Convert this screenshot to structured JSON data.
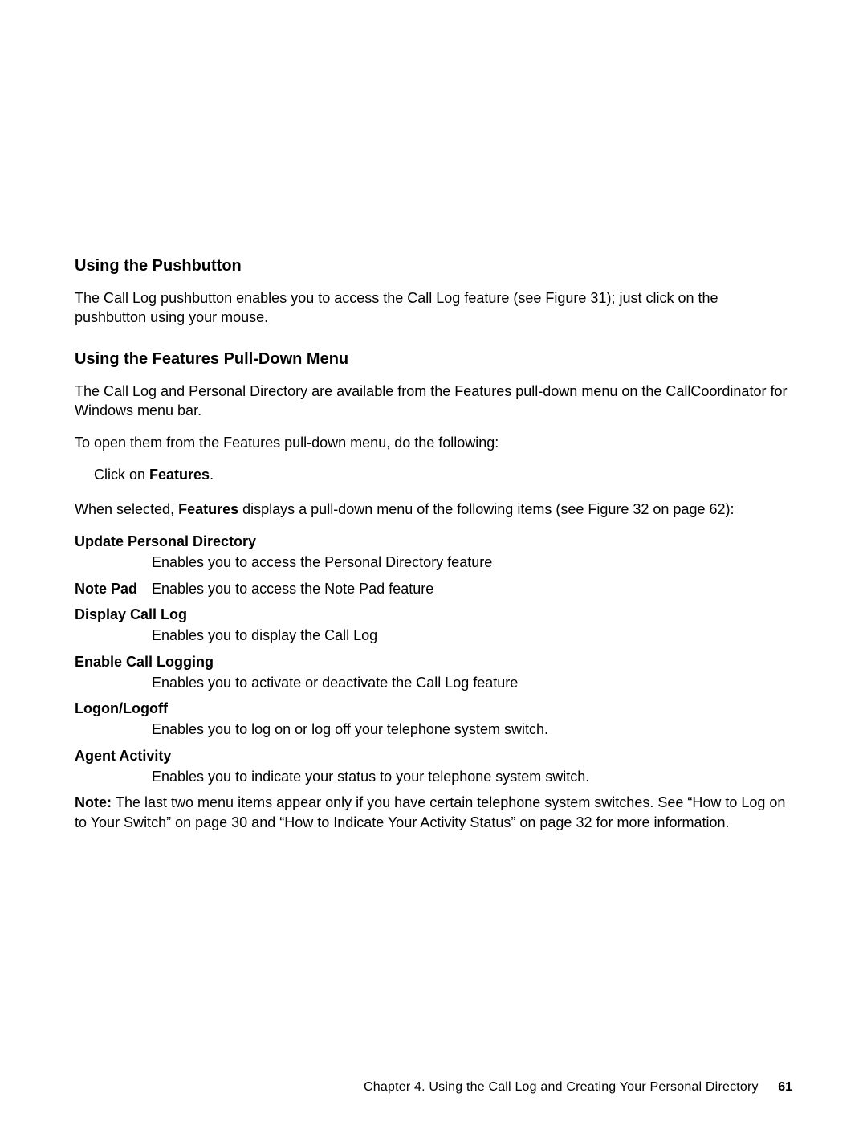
{
  "section1": {
    "heading": "Using the Pushbutton",
    "p1a": "The Call Log pushbutton enables you to access the Call Log feature (see Figure",
    "p1b": "31); just click on the pushbutton using your mouse."
  },
  "section2": {
    "heading": "Using the Features Pull-Down Menu",
    "p1": "The Call Log and Personal Directory are available from the Features pull-down menu on the CallCoordinator for Windows menu bar.",
    "p2": "To open them from the Features pull-down menu, do the following:",
    "click_prefix": "Click on ",
    "click_bold": "Features",
    "click_suffix": ".",
    "p3a": "When selected, ",
    "p3b": "Features",
    "p3c": " displays a pull-down menu of the following items (see Figure",
    "p3d": "32 on page",
    "p3e": "62):",
    "items": [
      {
        "term": "Update Personal Directory",
        "desc": "Enables you to access the Personal Directory feature",
        "layout": "stack"
      },
      {
        "term": "Note Pad",
        "desc": "Enables you to access the Note Pad feature",
        "layout": "inline"
      },
      {
        "term": "Display Call Log",
        "desc": "Enables you to display the Call Log",
        "layout": "stack"
      },
      {
        "term": "Enable Call Logging",
        "desc": "Enables you to activate or deactivate the Call Log feature",
        "layout": "stack"
      },
      {
        "term": "Logon/Logoff",
        "desc": "Enables you to log on or log off your telephone system switch.",
        "layout": "stack"
      },
      {
        "term": "Agent Activity",
        "desc": "Enables you to indicate your status to your telephone system switch.",
        "layout": "stack"
      }
    ],
    "note_label": "Note:  ",
    "note_body_a": "The last two menu items appear only if you have certain telephone system switches.  See “How to Log on to Your Switch” on page",
    "note_body_b": "30 and “How to Indicate Your Activity Status” on page",
    "note_body_c": "32 for more information."
  },
  "footer": {
    "chapter_label": "Chapter 4.  Using the Call Log and Creating Your Personal Directory",
    "page_number": "61"
  }
}
